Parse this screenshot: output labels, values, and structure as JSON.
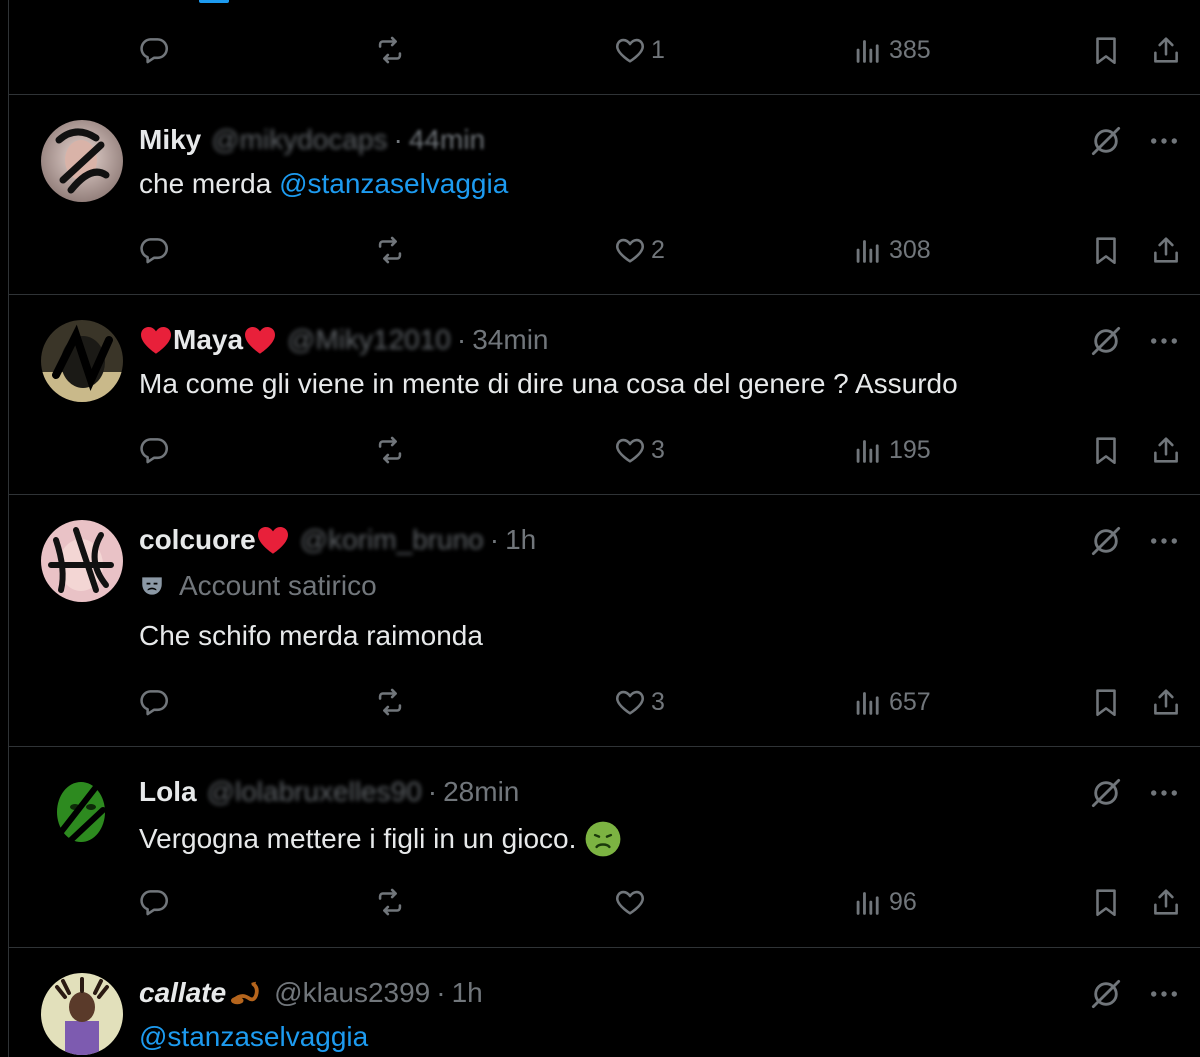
{
  "top_actions": {
    "likes": "1",
    "views": "385"
  },
  "tweets": [
    {
      "name": "Miky",
      "handle": "@mikydocaps",
      "time": "44min",
      "text": "che merda ",
      "mention": "@stanzaselvaggia",
      "likes": "2",
      "views": "308"
    },
    {
      "name": "Maya",
      "handle": "@Miky12010",
      "time": "34min",
      "text": "Ma come gli viene in mente di dire una cosa del genere ? Assurdo",
      "likes": "3",
      "views": "195"
    },
    {
      "name": "colcuore",
      "handle": "@korim_bruno",
      "time": "1h",
      "label": "Account satirico",
      "text": "Che schifo merda raimonda",
      "likes": "3",
      "views": "657"
    },
    {
      "name": "Lola",
      "handle": "@lolabruxelles90",
      "time": "28min",
      "text": "Vergogna mettere i figli in un gioco.",
      "likes": "",
      "views": "96"
    },
    {
      "name": "callate",
      "handle": "@klaus2399",
      "time": "1h",
      "mention": "@stanzaselvaggia"
    }
  ],
  "separator": "·",
  "colors": {
    "background": "#000000",
    "text": "#e7e9ea",
    "muted": "#71767b",
    "accent": "#1d9bf0",
    "divider": "#2f3336",
    "heart_red": "#e8203a"
  }
}
